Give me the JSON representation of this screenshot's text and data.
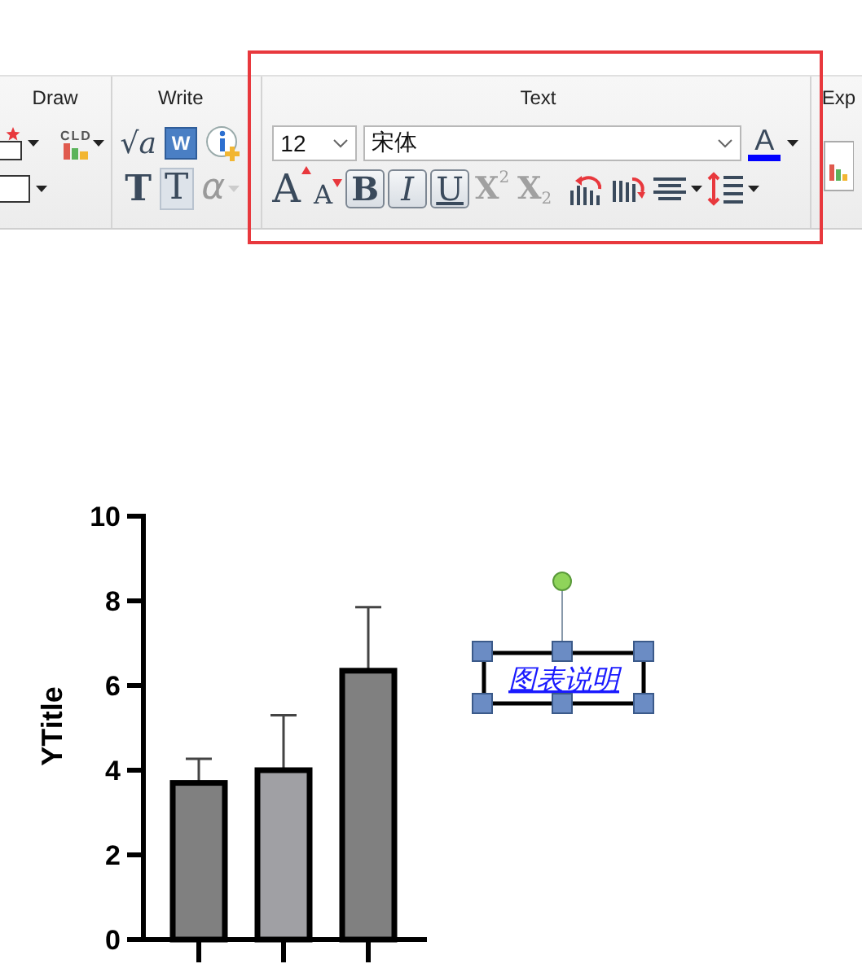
{
  "ribbon": {
    "draw": {
      "title": "Draw",
      "cld_label": "CLD"
    },
    "write": {
      "title": "Write",
      "tools": [
        {
          "kind": "equation",
          "label": "√a",
          "disabled": false
        },
        {
          "kind": "word",
          "label": "W",
          "disabled": false
        },
        {
          "kind": "plain",
          "label": "T",
          "disabled": false
        },
        {
          "kind": "framed",
          "label": "T",
          "disabled": false
        },
        {
          "kind": "greek",
          "label": "α",
          "disabled": true
        }
      ]
    },
    "text": {
      "title": "Text",
      "font_size": "12",
      "font_name": "宋体",
      "color_label": "A",
      "size_buttons": [
        {
          "kind": "grow",
          "label": "A"
        },
        {
          "kind": "shrink",
          "label": "A"
        }
      ],
      "styles": [
        {
          "kind": "bold",
          "label": "B",
          "selected": true
        },
        {
          "kind": "italic",
          "label": "I",
          "selected": true
        },
        {
          "kind": "underline",
          "label": "U",
          "selected": true
        }
      ],
      "scripts": [
        {
          "kind": "sup",
          "label": "X",
          "mark": "2",
          "disabled": true
        },
        {
          "kind": "sub",
          "label": "X",
          "mark": "2",
          "disabled": true
        }
      ]
    },
    "export_title": "Exp"
  },
  "graph": {
    "chart_data": {
      "type": "bar",
      "ylabel": "YTitle",
      "ylim": [
        0,
        10
      ],
      "yticks": [
        0,
        2,
        4,
        6,
        8,
        10
      ],
      "series": [
        {
          "color": "#808080",
          "values": [
            3.7,
            null,
            null
          ]
        },
        {
          "color": "#a0a0a4",
          "values": [
            null,
            4.0,
            null
          ]
        },
        {
          "color": "#808080",
          "values": [
            null,
            null,
            6.35
          ]
        }
      ]
    },
    "legend_box": {
      "text": "图表说明",
      "selected": true
    }
  }
}
